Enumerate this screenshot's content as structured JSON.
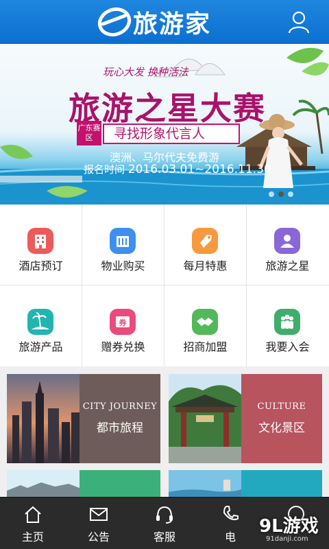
{
  "header": {
    "logo_text": "旅游家",
    "logo_icon": "e-logo-icon",
    "user_icon": "user-icon",
    "bg_color": "#1479d7"
  },
  "banner": {
    "slogan": "玩心大发 换种活法",
    "title": "旅游之星大赛",
    "tag": "广东赛区",
    "subtitle": "寻找形象代言人",
    "offer": "澳洲、马尔代夫免费游",
    "date_label": "报名时间",
    "date_range": "2016.03.01~2016.11.30",
    "slides_total": 3,
    "slide_active": 1
  },
  "menu": [
    {
      "label": "酒店预订",
      "icon": "hotel-icon",
      "color": "#ee5a5a"
    },
    {
      "label": "物业购买",
      "icon": "building-icon",
      "color": "#3d8ff0"
    },
    {
      "label": "每月特惠",
      "icon": "tag-icon",
      "color": "#f79a3e"
    },
    {
      "label": "旅游之星",
      "icon": "person-icon",
      "color": "#8a67d8"
    },
    {
      "label": "旅游产品",
      "icon": "island-icon",
      "color": "#22b5b0"
    },
    {
      "label": "赠券兑换",
      "icon": "coupon-icon",
      "color": "#ec4a7c"
    },
    {
      "label": "招商加盟",
      "icon": "handshake-icon",
      "color": "#52b95a"
    },
    {
      "label": "我要入会",
      "icon": "group-icon",
      "color": "#3fae6a"
    }
  ],
  "cards": [
    {
      "en": "CITY JOURNEY",
      "cn": "都市旅程",
      "panel_color": "#6e5c5a"
    },
    {
      "en": "CULTURE",
      "cn": "文化景区",
      "panel_color": "#b7545e"
    }
  ],
  "bottom_nav": [
    {
      "label": "主页",
      "icon": "home-icon"
    },
    {
      "label": "公告",
      "icon": "mail-icon"
    },
    {
      "label": "客服",
      "icon": "headset-icon"
    },
    {
      "label": "电",
      "icon": "phone-icon"
    },
    {
      "label": "",
      "icon": "circle-icon"
    }
  ],
  "watermark": {
    "main": "9L游戏",
    "sub": "91danji.com"
  }
}
